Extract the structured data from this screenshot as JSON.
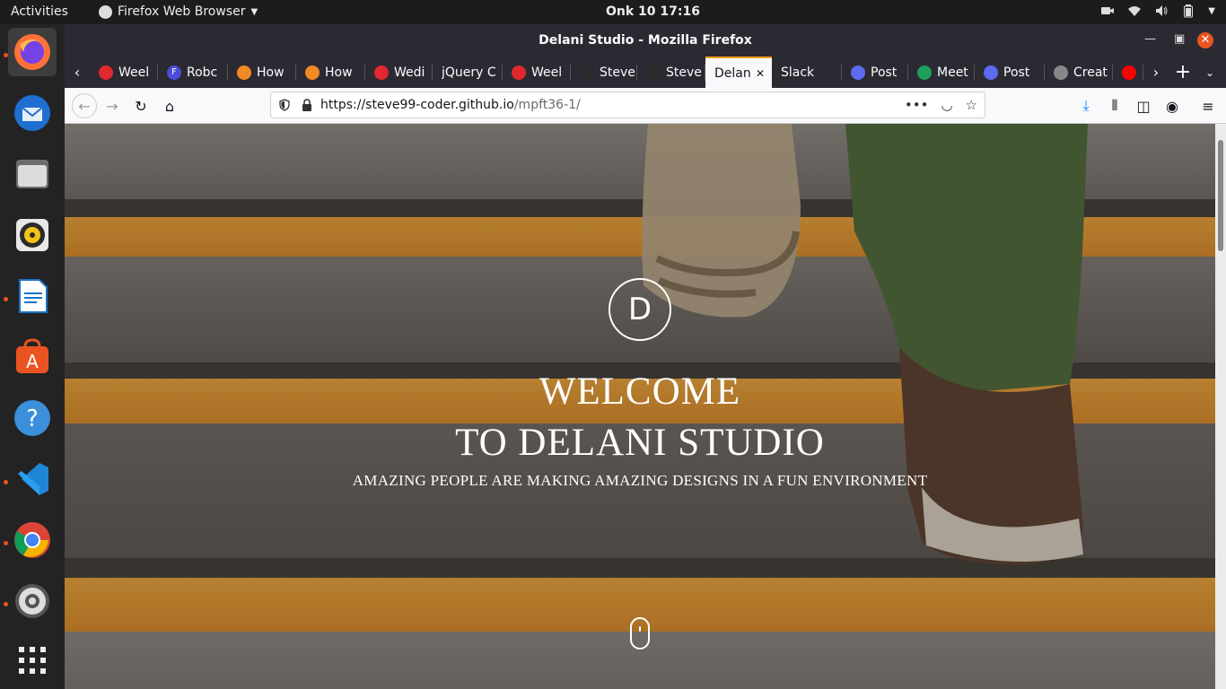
{
  "topbar": {
    "activities": "Activities",
    "app_name": "Firefox Web Browser",
    "clock": "Onk 10  17:16"
  },
  "window": {
    "title": "Delani Studio - Mozilla Firefox"
  },
  "tabs": [
    {
      "label": "Weel",
      "fav_color": "#e0282e"
    },
    {
      "label": "Robc",
      "fav_color": "#4b4bd9",
      "fav_letter": "F"
    },
    {
      "label": "How",
      "fav_color": "#f08a24"
    },
    {
      "label": "How",
      "fav_color": "#f08a24"
    },
    {
      "label": "Wedi",
      "fav_color": "#e0282e"
    },
    {
      "label": "jQuery C",
      "fav_color": ""
    },
    {
      "label": "Weel",
      "fav_color": "#e0282e"
    },
    {
      "label": "Steve",
      "fav_color": "#2a2a2a"
    },
    {
      "label": "Steve",
      "fav_color": "#2a2a2a"
    },
    {
      "label": "Delan",
      "fav_color": "",
      "selected": true
    },
    {
      "label": "Slack",
      "fav_color": ""
    },
    {
      "label": "Post",
      "fav_color": "#5c6bf0"
    },
    {
      "label": "Meet",
      "fav_color": "#1e9e5a"
    },
    {
      "label": "Post",
      "fav_color": "#5c6bf0"
    },
    {
      "label": "Creat",
      "fav_color": "#888"
    },
    {
      "label": "(",
      "fav_color": "#ff0000"
    }
  ],
  "navbar": {
    "url_host": "https://steve99-coder.github.io",
    "url_path": "/mpft36-1/"
  },
  "hero": {
    "logo_letter": "D",
    "title_line1": "WELCOME",
    "title_line2": "TO DELANI STUDIO",
    "tagline": "AMAZING PEOPLE ARE MAKING AMAZING DESIGNS IN A FUN ENVIRONMENT"
  },
  "dock": {
    "items": [
      "firefox-icon",
      "thunderbird-icon",
      "files-icon",
      "rhythmbox-icon",
      "writer-icon",
      "software-icon",
      "help-icon",
      "vscode-icon",
      "chrome-icon",
      "settings-icon",
      "app-grid-icon"
    ]
  }
}
